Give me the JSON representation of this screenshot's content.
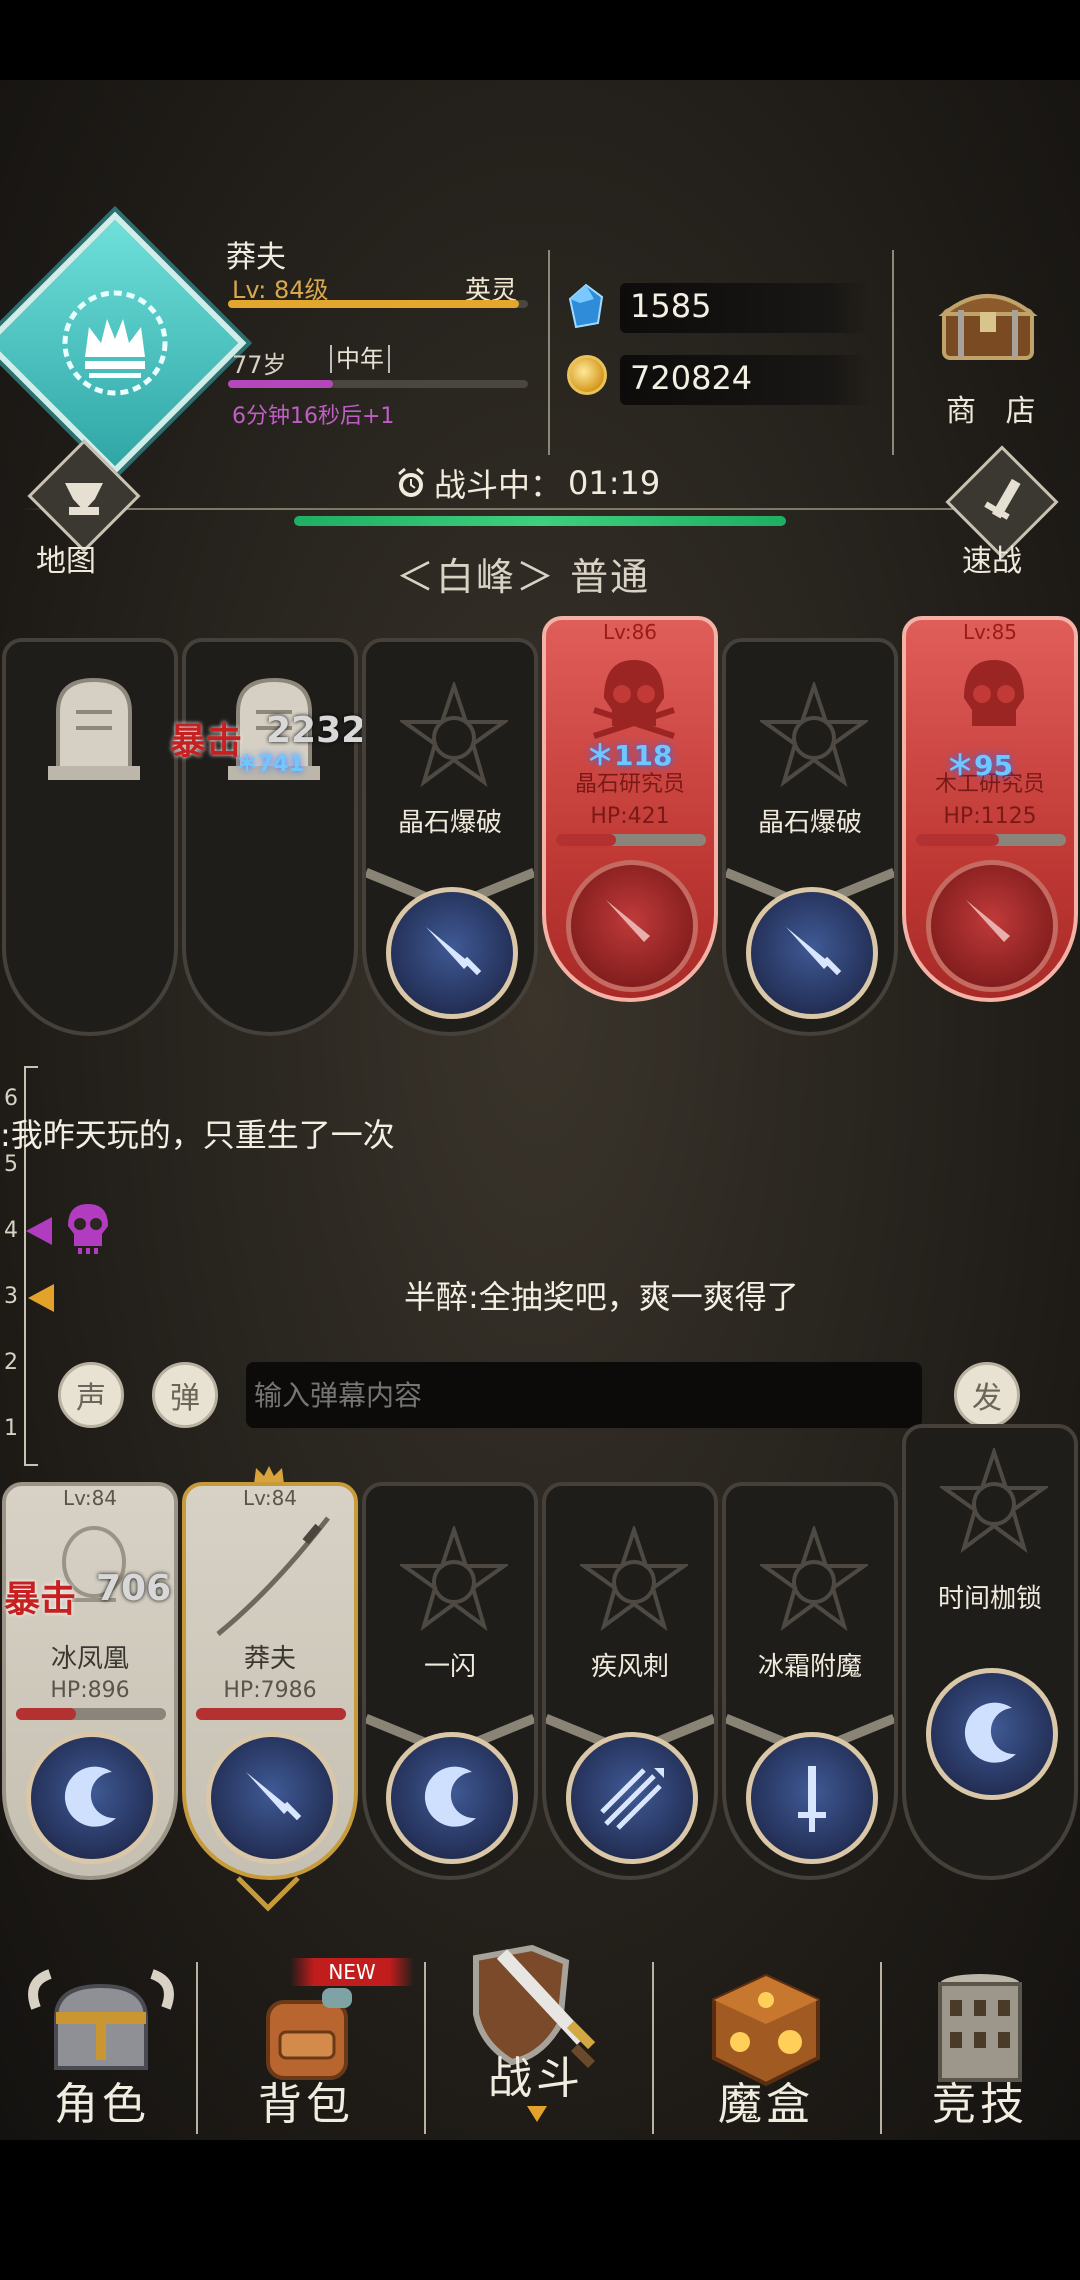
{
  "player": {
    "name": "莽夫",
    "level_text": "Lv: 84级",
    "level_progress": 0.97,
    "title": "英灵",
    "age": "77岁",
    "life_stage": "中年",
    "age_progress": 0.35,
    "timer_note": "6分钟16秒后+1"
  },
  "resources": {
    "gems": "1585",
    "gold": "720824"
  },
  "shop": {
    "label": "商 店"
  },
  "map": {
    "label": "地图"
  },
  "quick_battle": {
    "label": "速战"
  },
  "battle": {
    "status": "战斗中：",
    "time": "01:19",
    "stage": "＜白峰＞ 普通"
  },
  "enemy_cards": [
    {
      "type": "tombstone",
      "dmg_crit_label": "暴击",
      "dmg_value": "2232",
      "sub_value": "＊741"
    },
    {
      "type": "tombstone"
    },
    {
      "type": "skill",
      "skill": "晶石爆破"
    },
    {
      "type": "enemy",
      "level": "Lv:86",
      "name": "晶石研究员",
      "hp": "HP:421",
      "hp_ratio": 0.4,
      "blue_num": "＊118"
    },
    {
      "type": "skill",
      "skill": "晶石爆破"
    },
    {
      "type": "enemy",
      "level": "Lv:85",
      "name": "木工研究员",
      "hp": "HP:1125",
      "hp_ratio": 0.55,
      "blue_num": "＊95"
    }
  ],
  "chat": {
    "line1": ":我昨天玩的，只重生了一次",
    "line2": "半醉:全抽奖吧，爽一爽得了",
    "ruler_ticks": [
      "6",
      "5",
      "4",
      "3",
      "2",
      "1"
    ]
  },
  "danmaku": {
    "sound_btn": "声",
    "danmaku_btn": "弹",
    "placeholder": "输入弹幕内容",
    "send_btn": "发"
  },
  "ally_cards": [
    {
      "type": "hero",
      "level": "Lv:84",
      "name": "冰凤凰",
      "hp": "HP:896",
      "hp_ratio": 0.4,
      "crit_label": "暴击",
      "crit_value": "706"
    },
    {
      "type": "hero",
      "level": "Lv:84",
      "name": "莽夫",
      "hp": "HP:7986",
      "hp_ratio": 1.0
    },
    {
      "type": "skill",
      "skill": "一闪"
    },
    {
      "type": "skill",
      "skill": "疾风刺"
    },
    {
      "type": "skill",
      "skill": "冰霜附魔"
    },
    {
      "type": "skill",
      "skill": "时间枷锁"
    }
  ],
  "nav": {
    "character": "角色",
    "bag": "背包",
    "bag_badge": "NEW",
    "battle": "战斗",
    "magic_box": "魔盒",
    "arena": "竞技"
  },
  "colors": {
    "accent_green": "#3ed07d",
    "level_bar": "#e2a72c",
    "age_bar": "#b547bd",
    "crit_red": "#c62020",
    "enemy_red": "#c13a36"
  }
}
